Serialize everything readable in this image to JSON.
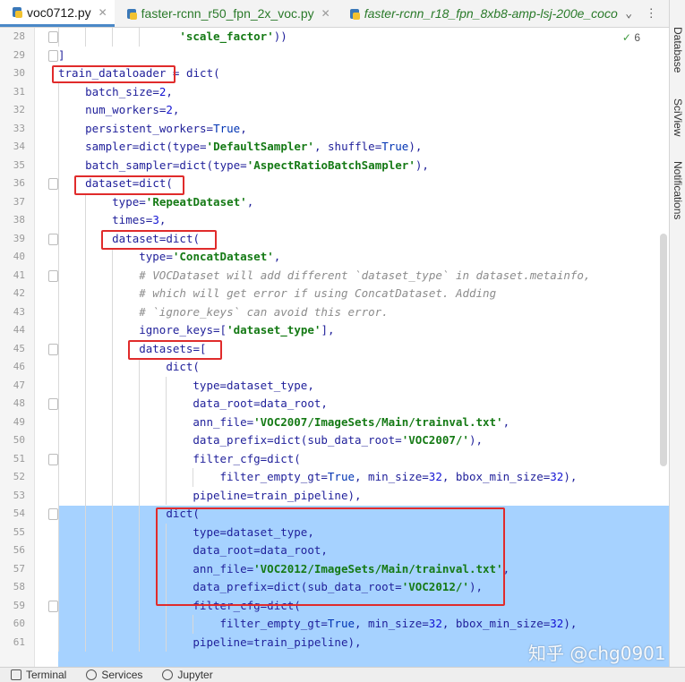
{
  "tabs": [
    {
      "label": "voc0712.py",
      "active": true,
      "style": "normal"
    },
    {
      "label": "faster-rcnn_r50_fpn_2x_voc.py",
      "active": false,
      "style": "pyc"
    },
    {
      "label": "faster-rcnn_r18_fpn_8xb8-amp-lsj-200e_coco",
      "active": false,
      "style": "it"
    }
  ],
  "tab_controls": {
    "dropdown": "⌄",
    "more": "⋮"
  },
  "inspection": {
    "icon": "✓",
    "count": "6"
  },
  "right_tools": [
    "Database",
    "SciView",
    "Notifications"
  ],
  "colors": {
    "selection": "#a6d2ff",
    "highlight_box": "#e02b2b",
    "string": "#157a15",
    "number": "#1313d4"
  },
  "lines": [
    {
      "n": "28",
      "indent": 18,
      "tokens": [
        {
          "t": "'scale_factor'",
          "c": "s"
        },
        {
          "t": "))",
          "c": "n"
        }
      ]
    },
    {
      "n": "29",
      "indent": 0,
      "tokens": [
        {
          "t": "]",
          "c": "n"
        }
      ]
    },
    {
      "n": "30",
      "indent": 0,
      "tokens": [
        {
          "t": "train_dataloader = dict(",
          "c": "n"
        }
      ]
    },
    {
      "n": "31",
      "indent": 4,
      "tokens": [
        {
          "t": "batch_size=",
          "c": "n"
        },
        {
          "t": "2",
          "c": "nm"
        },
        {
          "t": ",",
          "c": "n"
        }
      ]
    },
    {
      "n": "32",
      "indent": 4,
      "tokens": [
        {
          "t": "num_workers=",
          "c": "n"
        },
        {
          "t": "2",
          "c": "nm"
        },
        {
          "t": ",",
          "c": "n"
        }
      ]
    },
    {
      "n": "33",
      "indent": 4,
      "tokens": [
        {
          "t": "persistent_workers=",
          "c": "n"
        },
        {
          "t": "True",
          "c": "kw"
        },
        {
          "t": ",",
          "c": "n"
        }
      ]
    },
    {
      "n": "34",
      "indent": 4,
      "tokens": [
        {
          "t": "sampler=dict(type=",
          "c": "n"
        },
        {
          "t": "'DefaultSampler'",
          "c": "s"
        },
        {
          "t": ", shuffle=",
          "c": "n"
        },
        {
          "t": "True",
          "c": "kw"
        },
        {
          "t": "),",
          "c": "n"
        }
      ]
    },
    {
      "n": "35",
      "indent": 4,
      "tokens": [
        {
          "t": "batch_sampler=dict(type=",
          "c": "n"
        },
        {
          "t": "'AspectRatioBatchSampler'",
          "c": "s"
        },
        {
          "t": "),",
          "c": "n"
        }
      ]
    },
    {
      "n": "36",
      "indent": 4,
      "tokens": [
        {
          "t": "dataset=dict(",
          "c": "n"
        }
      ]
    },
    {
      "n": "37",
      "indent": 8,
      "tokens": [
        {
          "t": "type=",
          "c": "n"
        },
        {
          "t": "'RepeatDataset'",
          "c": "s"
        },
        {
          "t": ",",
          "c": "n"
        }
      ]
    },
    {
      "n": "38",
      "indent": 8,
      "tokens": [
        {
          "t": "times=",
          "c": "n"
        },
        {
          "t": "3",
          "c": "nm"
        },
        {
          "t": ",",
          "c": "n"
        }
      ]
    },
    {
      "n": "39",
      "indent": 8,
      "tokens": [
        {
          "t": "dataset=dict(",
          "c": "n"
        }
      ]
    },
    {
      "n": "40",
      "indent": 12,
      "tokens": [
        {
          "t": "type=",
          "c": "n"
        },
        {
          "t": "'ConcatDataset'",
          "c": "s"
        },
        {
          "t": ",",
          "c": "n"
        }
      ]
    },
    {
      "n": "41",
      "indent": 12,
      "tokens": [
        {
          "t": "# VOCDataset will add different `dataset_type` in dataset.metainfo,",
          "c": "cm"
        }
      ]
    },
    {
      "n": "42",
      "indent": 12,
      "tokens": [
        {
          "t": "# which will get error if using ConcatDataset. Adding",
          "c": "cm"
        }
      ]
    },
    {
      "n": "43",
      "indent": 12,
      "tokens": [
        {
          "t": "# `ignore_keys` can avoid this error.",
          "c": "cm"
        }
      ]
    },
    {
      "n": "44",
      "indent": 12,
      "tokens": [
        {
          "t": "ignore_keys=[",
          "c": "n"
        },
        {
          "t": "'dataset_type'",
          "c": "s"
        },
        {
          "t": "],",
          "c": "n"
        }
      ]
    },
    {
      "n": "45",
      "indent": 12,
      "tokens": [
        {
          "t": "datasets=[",
          "c": "n"
        }
      ]
    },
    {
      "n": "46",
      "indent": 16,
      "tokens": [
        {
          "t": "dict(",
          "c": "n"
        }
      ]
    },
    {
      "n": "47",
      "indent": 20,
      "tokens": [
        {
          "t": "type=dataset_type,",
          "c": "n"
        }
      ]
    },
    {
      "n": "48",
      "indent": 20,
      "tokens": [
        {
          "t": "data_root=data_root,",
          "c": "n"
        }
      ]
    },
    {
      "n": "49",
      "indent": 20,
      "tokens": [
        {
          "t": "ann_file=",
          "c": "n"
        },
        {
          "t": "'VOC2007/ImageSets/Main/trainval.txt'",
          "c": "s"
        },
        {
          "t": ",",
          "c": "n"
        }
      ]
    },
    {
      "n": "50",
      "indent": 20,
      "tokens": [
        {
          "t": "data_prefix=dict(sub_data_root=",
          "c": "n"
        },
        {
          "t": "'VOC2007/'",
          "c": "s"
        },
        {
          "t": "),",
          "c": "n"
        }
      ]
    },
    {
      "n": "51",
      "indent": 20,
      "tokens": [
        {
          "t": "filter_cfg=dict(",
          "c": "n"
        }
      ]
    },
    {
      "n": "52",
      "indent": 24,
      "tokens": [
        {
          "t": "filter_empty_gt=",
          "c": "n"
        },
        {
          "t": "True",
          "c": "kw"
        },
        {
          "t": ", min_size=",
          "c": "n"
        },
        {
          "t": "32",
          "c": "nm"
        },
        {
          "t": ", bbox_min_size=",
          "c": "n"
        },
        {
          "t": "32",
          "c": "nm"
        },
        {
          "t": "),",
          "c": "n"
        }
      ]
    },
    {
      "n": "53",
      "indent": 20,
      "tokens": [
        {
          "t": "pipeline=train_pipeline),",
          "c": "n"
        }
      ]
    },
    {
      "n": "54",
      "indent": 16,
      "tokens": [
        {
          "t": "dict(",
          "c": "n"
        }
      ]
    },
    {
      "n": "55",
      "indent": 20,
      "tokens": [
        {
          "t": "type=dataset_type,",
          "c": "n"
        }
      ]
    },
    {
      "n": "56",
      "indent": 20,
      "tokens": [
        {
          "t": "data_root=data_root,",
          "c": "n"
        }
      ]
    },
    {
      "n": "57",
      "indent": 20,
      "tokens": [
        {
          "t": "ann_file=",
          "c": "n"
        },
        {
          "t": "'VOC2012/ImageSets/Main/trainval.txt'",
          "c": "s"
        },
        {
          "t": ",",
          "c": "n"
        }
      ]
    },
    {
      "n": "58",
      "indent": 20,
      "tokens": [
        {
          "t": "data_prefix=dict(sub_data_root=",
          "c": "n"
        },
        {
          "t": "'VOC2012/'",
          "c": "s"
        },
        {
          "t": "),",
          "c": "n"
        }
      ]
    },
    {
      "n": "59",
      "indent": 20,
      "tokens": [
        {
          "t": "filter_cfg=dict(",
          "c": "n"
        }
      ]
    },
    {
      "n": "60",
      "indent": 24,
      "tokens": [
        {
          "t": "filter_empty_gt=",
          "c": "n"
        },
        {
          "t": "True",
          "c": "kw"
        },
        {
          "t": ", min_size=",
          "c": "n"
        },
        {
          "t": "32",
          "c": "nm"
        },
        {
          "t": ", bbox_min_size=",
          "c": "n"
        },
        {
          "t": "32",
          "c": "nm"
        },
        {
          "t": "),",
          "c": "n"
        }
      ]
    },
    {
      "n": "61",
      "indent": 20,
      "tokens": [
        {
          "t": "pipeline=train_pipeline),",
          "c": "n"
        }
      ]
    }
  ],
  "bottom_tools": [
    "Terminal",
    "Services",
    "Jupyter"
  ],
  "watermark": "知乎 @chg0901"
}
